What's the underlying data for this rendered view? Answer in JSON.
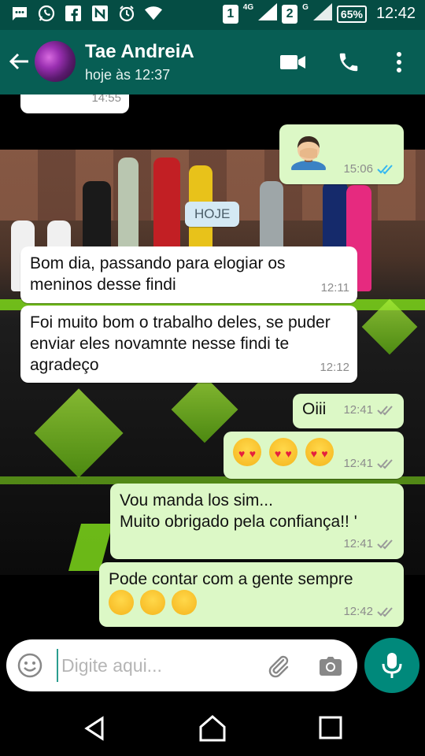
{
  "status_bar": {
    "icons": [
      "sms-icon",
      "whatsapp-icon",
      "facebook-icon",
      "nfc-icon",
      "alarm-icon",
      "wifi-icon"
    ],
    "sim1": "1",
    "sim1_network": "4G",
    "sim2": "2",
    "sim2_network": "G",
    "battery": "65%",
    "time": "12:42"
  },
  "header": {
    "contact_name": "Tae AndreiA",
    "last_seen": "hoje às 12:37",
    "accent": "#075e54"
  },
  "messages": [
    {
      "dir": "in",
      "text": "",
      "time": "14:55"
    },
    {
      "dir": "out",
      "emoji": "facepalm-emoji",
      "time": "15:06",
      "status": "read"
    },
    {
      "dir": "in",
      "text": "Bom dia, passando para elogiar os meninos desse findi",
      "time": "12:11"
    },
    {
      "dir": "in",
      "text": "Foi muito bom o trabalho deles, se puder enviar eles novamnte nesse findi te agradeço",
      "time": "12:12"
    },
    {
      "dir": "out",
      "text": "Oiii",
      "time": "12:41",
      "status": "delivered"
    },
    {
      "dir": "out",
      "emoji": "heart-eyes-emoji x3",
      "time": "12:41",
      "status": "delivered"
    },
    {
      "dir": "out",
      "line1": "Vou manda los sim...",
      "line2": "Muito obrigado pela confiança!! '",
      "time": "12:41",
      "status": "delivered"
    },
    {
      "dir": "out",
      "text": "Pode contar com a gente sempre",
      "emoji": "hugging-emoji x3",
      "time": "12:42",
      "status": "delivered"
    }
  ],
  "date_divider": "HOJE",
  "composer": {
    "placeholder": "Digite aqui...",
    "value": ""
  },
  "colors": {
    "outgoing": "#dcf8c6",
    "incoming": "#ffffff",
    "mic": "#00897b",
    "read_tick": "#34b7f1"
  }
}
